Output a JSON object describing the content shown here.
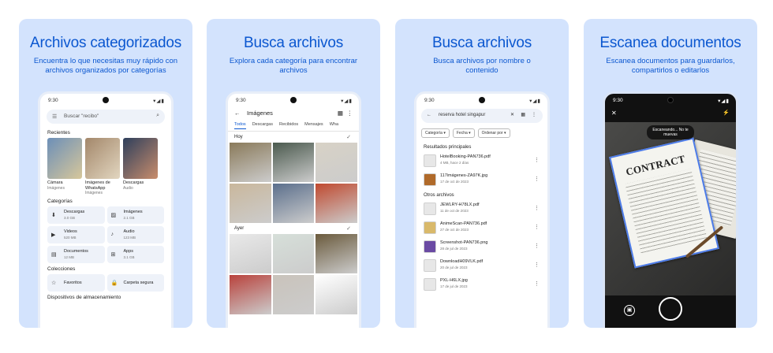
{
  "cards": [
    {
      "title": "Archivos categorizados",
      "subtitle": "Encuentra lo que necesitas muy rápido con archivos organizados por categorías"
    },
    {
      "title": "Busca archivos",
      "subtitle": "Explora cada categoría para encontrar archivos"
    },
    {
      "title": "Busca archivos",
      "subtitle": "Busca archivos por nombre o contenido"
    },
    {
      "title": "Escanea documentos",
      "subtitle": "Escanea documentos para guardarlos, compartirlos o editarlos"
    }
  ],
  "status": {
    "time": "9:30",
    "signal": "▾◢▮"
  },
  "icons": {
    "menu": "☰",
    "search": "⌕",
    "back": "←",
    "grid": "▦",
    "more": "⋮",
    "check": "✓",
    "close": "✕",
    "flash": "⚡",
    "gallery": "▣",
    "star": "☆",
    "lock": "🔒",
    "download": "⬇",
    "image": "▨",
    "video": "▶",
    "audio": "♪",
    "doc": "▤",
    "apps": "⊞"
  },
  "screen1": {
    "search_placeholder": "Buscar \"recibo\"",
    "recents_heading": "Recientes",
    "recents": [
      {
        "label": "Cámara",
        "sub": "Imágenes",
        "colors": [
          "#6c8fb8",
          "#d7c79b"
        ]
      },
      {
        "label": "Imágenes de WhatsApp",
        "sub": "Imágenes",
        "colors": [
          "#a3876a",
          "#e2d6c0"
        ]
      },
      {
        "label": "Descargas",
        "sub": "Audio",
        "colors": [
          "#2e3f5c",
          "#c98d6c"
        ]
      }
    ],
    "categories_heading": "Categorías",
    "categories": [
      {
        "name": "Descargas",
        "size": "3.0 GB",
        "icon": "download"
      },
      {
        "name": "Imágenes",
        "size": "2.1 GB",
        "icon": "image"
      },
      {
        "name": "Videos",
        "size": "520 MB",
        "icon": "video"
      },
      {
        "name": "Audio",
        "size": "123 MB",
        "icon": "audio"
      },
      {
        "name": "Documentos",
        "size": "12 MB",
        "icon": "doc"
      },
      {
        "name": "Apps",
        "size": "3.1 GB",
        "icon": "apps"
      }
    ],
    "collections_heading": "Colecciones",
    "collections": [
      {
        "name": "Favoritos",
        "icon": "star"
      },
      {
        "name": "Carpeta segura",
        "icon": "lock"
      }
    ],
    "storage_heading": "Dispositivos de almacenamiento"
  },
  "screen2": {
    "title": "Imágenes",
    "tabs": [
      "Todos",
      "Descargas",
      "Recibidos",
      "Mensajes",
      "Wha"
    ],
    "active_tab": 0,
    "group_today": "Hoy",
    "group_yesterday": "Ayer",
    "today_tiles": [
      "#8a7a5a",
      "#4b5a4e",
      "#d8d2c6",
      "#c9b79c",
      "#5b6f8c",
      "#c0492f"
    ],
    "yesterday_tiles": [
      "#e9e9e9",
      "#d6dfd9",
      "#6a5a3c",
      "#b9423c",
      "#c9c3bb",
      "#ffffff"
    ]
  },
  "screen3": {
    "query": "reserva hotel singapur",
    "chips": [
      "Categoría ▾",
      "Fecha ▾",
      "Ordenar por ▾"
    ],
    "main_heading": "Resultados principales",
    "main_results": [
      {
        "name": "HotelBooking-PAN736.pdf",
        "meta": "4 MB, hace 2 días",
        "color": "#e7e7e7"
      },
      {
        "name": "117imágenes-ZA97K.jpg",
        "meta": "17 de oct de 2023",
        "color": "#b06a2a"
      }
    ],
    "other_heading": "Otros archivos",
    "other_results": [
      {
        "name": "JEWLRY-H78LX.pdf",
        "meta": "11 de oct de 2023",
        "color": "#e7e7e7"
      },
      {
        "name": "AnimeScan-PAN736.pdf",
        "meta": "27 de oct de 2023",
        "color": "#d9b96a"
      },
      {
        "name": "Screenshot-PAN736.png",
        "meta": "28 de jul de 2023",
        "color": "#6a4aa3"
      },
      {
        "name": "DownloadH09VLK.pdf",
        "meta": "20 de jul de 2023",
        "color": "#e7e7e7"
      },
      {
        "name": "PXL-H6LX.jpg",
        "meta": "17 de jul de 2023",
        "color": "#e7e7e7"
      }
    ]
  },
  "screen4": {
    "hint": "Escaneando... No te muevas",
    "doc_word": "CONTRACT"
  }
}
